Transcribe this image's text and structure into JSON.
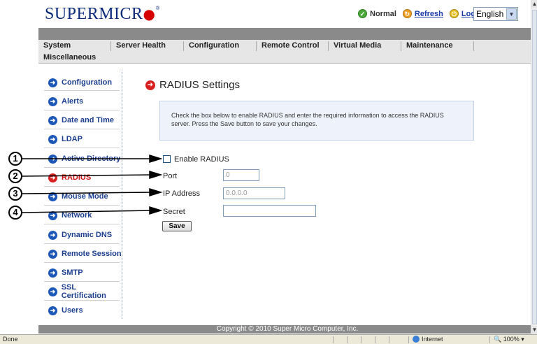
{
  "header": {
    "logo_text": "SUPERMICR",
    "logo_mark": "●",
    "logo_tm": "®",
    "status_normal": "Normal",
    "refresh_link": "Refresh",
    "logout_link": "Logout",
    "language": "English"
  },
  "nav": {
    "tabs": [
      "System",
      "Server Health",
      "Configuration",
      "Remote Control",
      "Virtual Media",
      "Maintenance",
      "Miscellaneous"
    ]
  },
  "sidebar": {
    "items": [
      {
        "label": "Configuration"
      },
      {
        "label": "Alerts"
      },
      {
        "label": "Date and Time"
      },
      {
        "label": "LDAP"
      },
      {
        "label": "Active Directory"
      },
      {
        "label": "RADIUS"
      },
      {
        "label": "Mouse Mode"
      },
      {
        "label": "Network"
      },
      {
        "label": "Dynamic DNS"
      },
      {
        "label": "Remote Session"
      },
      {
        "label": "SMTP"
      },
      {
        "label": "SSL Certification"
      },
      {
        "label": "Users"
      }
    ],
    "active_item": "RADIUS"
  },
  "content": {
    "title": "RADIUS Settings",
    "info_text": "Check the box below to enable RADIUS and enter the required information to access the RADIUS server. Press the Save button to save your changes.",
    "enable_label": "Enable RADIUS",
    "port_label": "Port",
    "port_value": "0",
    "ip_label": "IP Address",
    "ip_value": "0.0.0.0",
    "secret_label": "Secret",
    "secret_value": "",
    "save_label": "Save"
  },
  "callouts": [
    "1",
    "2",
    "3",
    "4"
  ],
  "footer": {
    "copyright": "Copyright © 2010 Super Micro Computer, Inc."
  },
  "statusbar": {
    "status_text": "Done",
    "zone": "Internet",
    "zoom": "100%"
  },
  "colors": {
    "brand": "#0b2a7a",
    "accent_red": "#d92020",
    "link_blue": "#1d3f8f",
    "nav_bg": "#e6e6e6",
    "footer_bg": "#8a8a8a"
  },
  "icons": {
    "status_normal": "check-circle-icon",
    "refresh": "refresh-icon",
    "logout": "logout-icon",
    "sidebar_arrow": "arrow-right-circle-icon"
  }
}
